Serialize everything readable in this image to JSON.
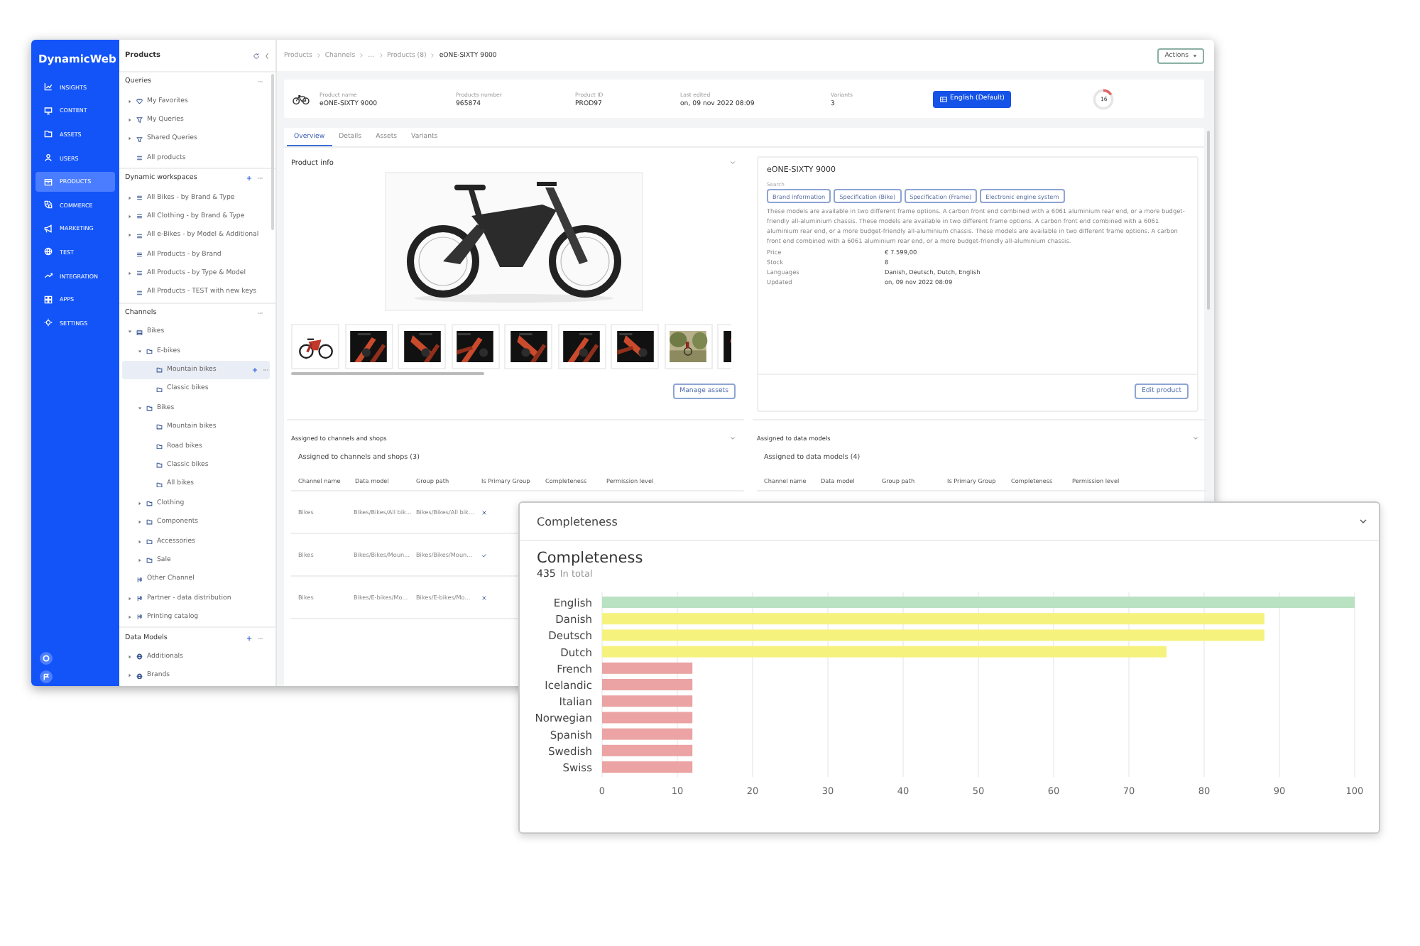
{
  "nav": {
    "logo": "DynamicWeb",
    "items": [
      {
        "label": "INSIGHTS",
        "kind": "chart",
        "selected": false
      },
      {
        "label": "CONTENT",
        "kind": "monitor",
        "selected": false
      },
      {
        "label": "ASSETS",
        "kind": "folder",
        "selected": false
      },
      {
        "label": "USERS",
        "kind": "user",
        "selected": false
      },
      {
        "label": "PRODUCTS",
        "kind": "box",
        "selected": true
      },
      {
        "label": "COMMERCE",
        "kind": "shapes",
        "selected": false
      },
      {
        "label": "MARKETING",
        "kind": "megaphone",
        "selected": false
      },
      {
        "label": "TEST",
        "kind": "globe",
        "selected": false
      },
      {
        "label": "INTEGRATION",
        "kind": "wave",
        "selected": false
      },
      {
        "label": "APPS",
        "kind": "grid",
        "selected": false
      },
      {
        "label": "SETTINGS",
        "kind": "gear",
        "selected": false
      }
    ]
  },
  "tree": {
    "title": "Products",
    "sections": [
      {
        "title": "Queries",
        "addable": false,
        "items": [
          {
            "label": "My Favorites",
            "kind": "heart",
            "expanded": false,
            "selected": false
          },
          {
            "label": "My Queries",
            "kind": "funnel",
            "expanded": false,
            "selected": false
          },
          {
            "label": "Shared Queries",
            "kind": "funnel",
            "expanded": false,
            "selected": false
          },
          {
            "label": "All products",
            "kind": "list",
            "selected": false
          }
        ]
      },
      {
        "title": "Dynamic workspaces",
        "addable": true,
        "items": [
          {
            "label": "All Bikes - by Brand & Type",
            "kind": "list",
            "expanded": false,
            "selected": false
          },
          {
            "label": "All Clothing - by Brand & Type",
            "kind": "list",
            "expanded": false,
            "selected": false
          },
          {
            "label": "All e-Bikes - by Model & Additional",
            "kind": "list",
            "expanded": false,
            "selected": false
          },
          {
            "label": "All Products - by Brand",
            "kind": "list",
            "selected": false
          },
          {
            "label": "All Products - by Type & Model",
            "kind": "list",
            "expanded": false,
            "selected": false
          },
          {
            "label": "All Products - TEST with new keys",
            "kind": "list",
            "selected": false
          }
        ]
      },
      {
        "title": "Channels",
        "addable": false,
        "items": [
          {
            "label": "Bikes",
            "kind": "stack",
            "expanded": true,
            "selected": false,
            "children": [
              {
                "label": "E-bikes",
                "kind": "folder",
                "expanded": true,
                "selected": false,
                "children": [
                  {
                    "label": "Mountain bikes",
                    "kind": "folder",
                    "selected": true
                  },
                  {
                    "label": "Classic bikes",
                    "kind": "folder",
                    "selected": false
                  }
                ]
              },
              {
                "label": "Bikes",
                "kind": "folder",
                "expanded": true,
                "selected": false,
                "children": [
                  {
                    "label": "Mountain bikes",
                    "kind": "folder",
                    "selected": false
                  },
                  {
                    "label": "Road bikes",
                    "kind": "folder",
                    "selected": false
                  },
                  {
                    "label": "Classic bikes",
                    "kind": "folder",
                    "selected": false
                  },
                  {
                    "label": "All bikes",
                    "kind": "folder",
                    "selected": false
                  }
                ]
              },
              {
                "label": "Clothing",
                "kind": "folder",
                "expanded": false,
                "selected": false
              },
              {
                "label": "Components",
                "kind": "folder",
                "expanded": false,
                "selected": false
              },
              {
                "label": "Accessories",
                "kind": "folder",
                "expanded": false,
                "selected": false
              },
              {
                "label": "Sale",
                "kind": "folder",
                "expanded": false,
                "selected": false
              }
            ]
          },
          {
            "label": "Other Channel",
            "kind": "branch",
            "selected": false
          },
          {
            "label": "Partner - data distribution",
            "kind": "branch",
            "expanded": false,
            "selected": false
          },
          {
            "label": "Printing catalog",
            "kind": "branch",
            "expanded": false,
            "selected": false
          }
        ]
      },
      {
        "title": "Data Models",
        "addable": true,
        "items": [
          {
            "label": "Additionals",
            "kind": "globe",
            "expanded": false,
            "selected": false
          },
          {
            "label": "Brands",
            "kind": "globe",
            "expanded": false,
            "selected": false
          }
        ]
      }
    ]
  },
  "breadcrumbs": [
    "Products",
    "Channels",
    "...",
    "Products (8)",
    "eONE-SIXTY 9000"
  ],
  "actions": "Actions",
  "header": {
    "fields": [
      {
        "label": "Product name",
        "value": "eONE-SIXTY 9000"
      },
      {
        "label": "Products number",
        "value": "965874"
      },
      {
        "label": "Product ID",
        "value": "PROD97"
      },
      {
        "label": "Last edited",
        "value": "on, 09 nov 2022 08:09"
      },
      {
        "label": "Variants",
        "value": "3"
      }
    ],
    "language": "English (Default)",
    "completeness": {
      "reading": "16",
      "level": 0.16
    }
  },
  "tabs": [
    {
      "label": "Overview",
      "selected": true
    },
    {
      "label": "Details",
      "selected": false
    },
    {
      "label": "Assets",
      "selected": false
    },
    {
      "label": "Variants",
      "selected": false
    }
  ],
  "product_info": {
    "title": "Product info",
    "manage": "Manage assets"
  },
  "summary": {
    "name": "eONE-SIXTY 9000",
    "tags_label": "Search",
    "tags": [
      "Brand information",
      "Specification (Bike)",
      "Specification (Frame)",
      "Electronic engine system"
    ],
    "description": "These models are available in two different frame options. A carbon front end combined with a 6061 aluminium rear end, or a more budget-friendly all-aluminium chassis. These models are available in two different frame options. A carbon front end combined with a 6061 aluminium rear end, or a more budget-friendly all-aluminium chassis. These models are available in two different frame options. A carbon front end combined with a 6061 aluminium rear end, or a more budget-friendly all-aluminium chassis.",
    "properties": [
      {
        "label": "Price",
        "value": "€ 7.599,00"
      },
      {
        "label": "Stock",
        "value": "8"
      },
      {
        "label": "Languages",
        "value": "Danish, Deutsch, Dutch, English"
      },
      {
        "label": "Updated",
        "value": "on, 09 nov 2022 08:09"
      }
    ],
    "edit": "Edit product"
  },
  "channels_panel": {
    "title": "Assigned to channels and shops",
    "subtitle": "Assigned to channels and shops (3)",
    "columns": [
      "Channel name",
      "Data model",
      "Group path",
      "Is Primary Group",
      "Completeness",
      "Permission level"
    ],
    "rows": [
      {
        "channel": "Bikes",
        "data_model": "Bikes/Bikes/All bik...",
        "group_path": "Bikes/Bikes/All bik...",
        "primary": false
      },
      {
        "channel": "Bikes",
        "data_model": "Bikes/Bikes/Moun...",
        "group_path": "Bikes/Bikes/Moun...",
        "primary": true
      },
      {
        "channel": "Bikes",
        "data_model": "Bikes/E-bikes/Mo...",
        "group_path": "Bikes/E-bikes/Mo...",
        "primary": false
      }
    ]
  },
  "models_panel": {
    "title": "Assigned to data models",
    "subtitle": "Assigned to data models (4)",
    "columns": [
      "Channel name",
      "Data model",
      "Group path",
      "Is Primary Group",
      "Completeness",
      "Permission level"
    ]
  },
  "popup": {
    "title": "Completeness",
    "heading": "Completeness",
    "total": "435",
    "total_label": "In total",
    "chart_data": {
      "type": "bar",
      "orientation": "horizontal",
      "categories": [
        "English",
        "Danish",
        "Deutsch",
        "Dutch",
        "French",
        "Icelandic",
        "Italian",
        "Norwegian",
        "Spanish",
        "Swedish",
        "Swiss"
      ],
      "values": [
        100,
        88,
        88,
        75,
        12,
        12,
        12,
        12,
        12,
        12,
        12
      ],
      "grid": true,
      "xlim": [
        0,
        100
      ],
      "xticks": [
        0,
        10,
        20,
        30,
        40,
        50,
        60,
        70,
        80,
        90,
        100
      ]
    }
  }
}
